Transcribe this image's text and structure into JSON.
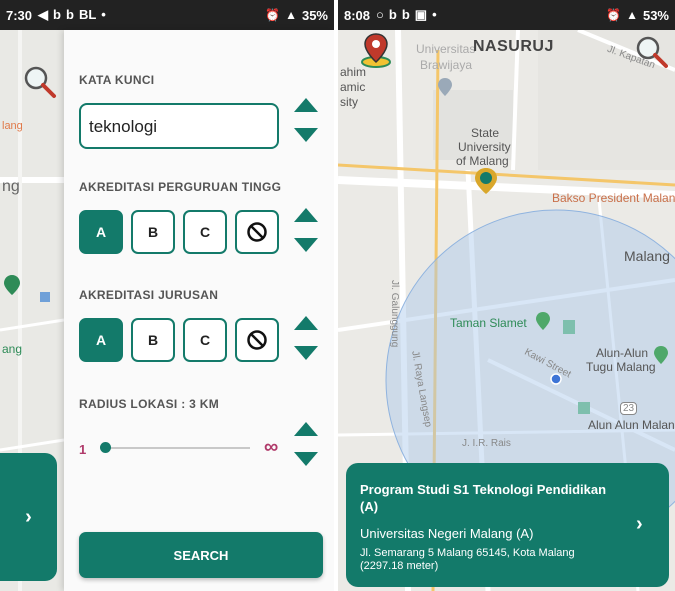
{
  "left_screen": {
    "status": {
      "time": "7:30",
      "icons": [
        "◀",
        "b",
        "b",
        "BL",
        "•"
      ],
      "battery": "35%"
    },
    "map_labels": {
      "lang": "lang",
      "ng": "ng",
      "ang": "ang"
    },
    "side_button": {
      "label": "›"
    },
    "filter": {
      "keyword_label": "KATA KUNCI",
      "keyword_value": "teknologi",
      "pt_accreditation_label": "AKREDITASI PERGURUAN TINGG",
      "pt_options": [
        "A",
        "B",
        "C"
      ],
      "pt_selected": "A",
      "major_accreditation_label": "AKREDITASI JURUSAN",
      "major_options": [
        "A",
        "B",
        "C"
      ],
      "major_selected": "A",
      "radius_label": "RADIUS LOKASI : 3 KM",
      "radius_min": "1",
      "radius_max": "∞",
      "radius_value_km": 3,
      "search_label": "SEARCH"
    }
  },
  "right_screen": {
    "status": {
      "time": "8:08",
      "icons": [
        "○",
        "b",
        "b",
        "▣",
        "•"
      ],
      "battery": "53%"
    },
    "app_title": "NASURUJ",
    "map_labels": {
      "universitas": "Universitas",
      "brawijaya": "Brawijaya",
      "ahim": "ahim",
      "amic": "amic",
      "sity": "sity",
      "state_univ_1": "State",
      "state_univ_2": "University",
      "state_univ_3": "of Malang",
      "bakso": "Bakso President Malan",
      "malang": "Malang",
      "galunggung": "Jl. Galunggung",
      "taman_slamet": "Taman Slamet",
      "alun_tugu_1": "Alun-Alun",
      "alun_tugu_2": "Tugu Malang",
      "kawi": "Kawi Street",
      "raya_langsep": "Jl. Raya Langsep",
      "alun_alun": "Alun Alun Malang",
      "jir_rais": "J. I.R. Rais",
      "kaptan": "Jl. Kapatan",
      "route_23": "23"
    },
    "result": {
      "title": "Program Studi S1 Teknologi Pendidikan (A)",
      "university": "Universitas Negeri Malang (A)",
      "address": "Jl. Semarang 5 Malang 65145, Kota Malang (2297.18 meter)",
      "arrow": "›"
    }
  },
  "colors": {
    "primary": "#137a6a",
    "accent": "#b03a6a",
    "map_radius": "#a9c8ea"
  }
}
